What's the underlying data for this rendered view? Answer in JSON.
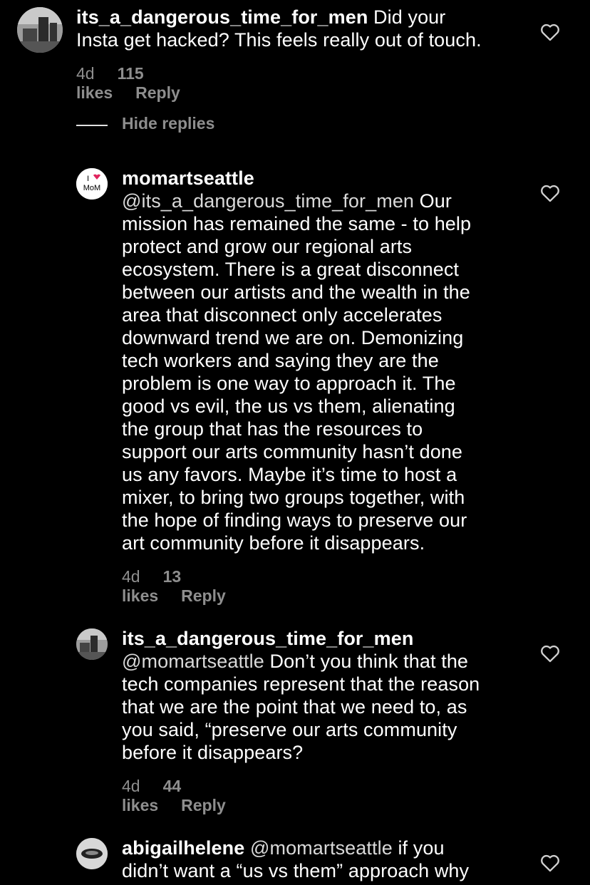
{
  "comments": [
    {
      "username": "its_a_dangerous_time_for_men",
      "mention": "",
      "text": " Did your\nInsta get hacked? This feels really out of touch.",
      "time": "4d",
      "likes": "115 likes",
      "reply": "Reply"
    },
    {
      "username": "momartseattle",
      "mention": "@its_a_dangerous_time_for_men",
      "text": " Our\nmission has remained the same - to help\nprotect and grow our regional arts\necosystem. There is a great disconnect\nbetween our artists and the wealth in the\narea that disconnect only accelerates\ndownward trend we are on. Demonizing\ntech workers and saying they are the\nproblem is one way to approach it. The\ngood vs evil, the us vs them, alienating\nthe group that has the resources to\nsupport our arts community hasn’t done\nus any favors. Maybe it’s time to host a\nmixer, to bring two groups together, with\nthe hope of finding ways to preserve our\nart community before it disappears.",
      "time": "4d",
      "likes": "13 likes",
      "reply": "Reply",
      "avatar_text": "MoM"
    },
    {
      "username": "its_a_dangerous_time_for_men",
      "mention": "@momartseattle",
      "text": " Don’t you think that the\ntech companies represent that the reason\nthat we are the point that we need to, as\nyou said, “preserve our arts community\nbefore it disappears?",
      "time": "4d",
      "likes": "44 likes",
      "reply": "Reply"
    },
    {
      "username": "abigailhelene",
      "mention": "@momartseattle",
      "text": " if you\ndidn’t want a “us vs them” approach why"
    }
  ],
  "hide_replies": "Hide replies",
  "colors": {
    "background": "#000000",
    "text": "#ffffff",
    "muted": "#8e8e8e",
    "heart_red": "#e0245e"
  }
}
